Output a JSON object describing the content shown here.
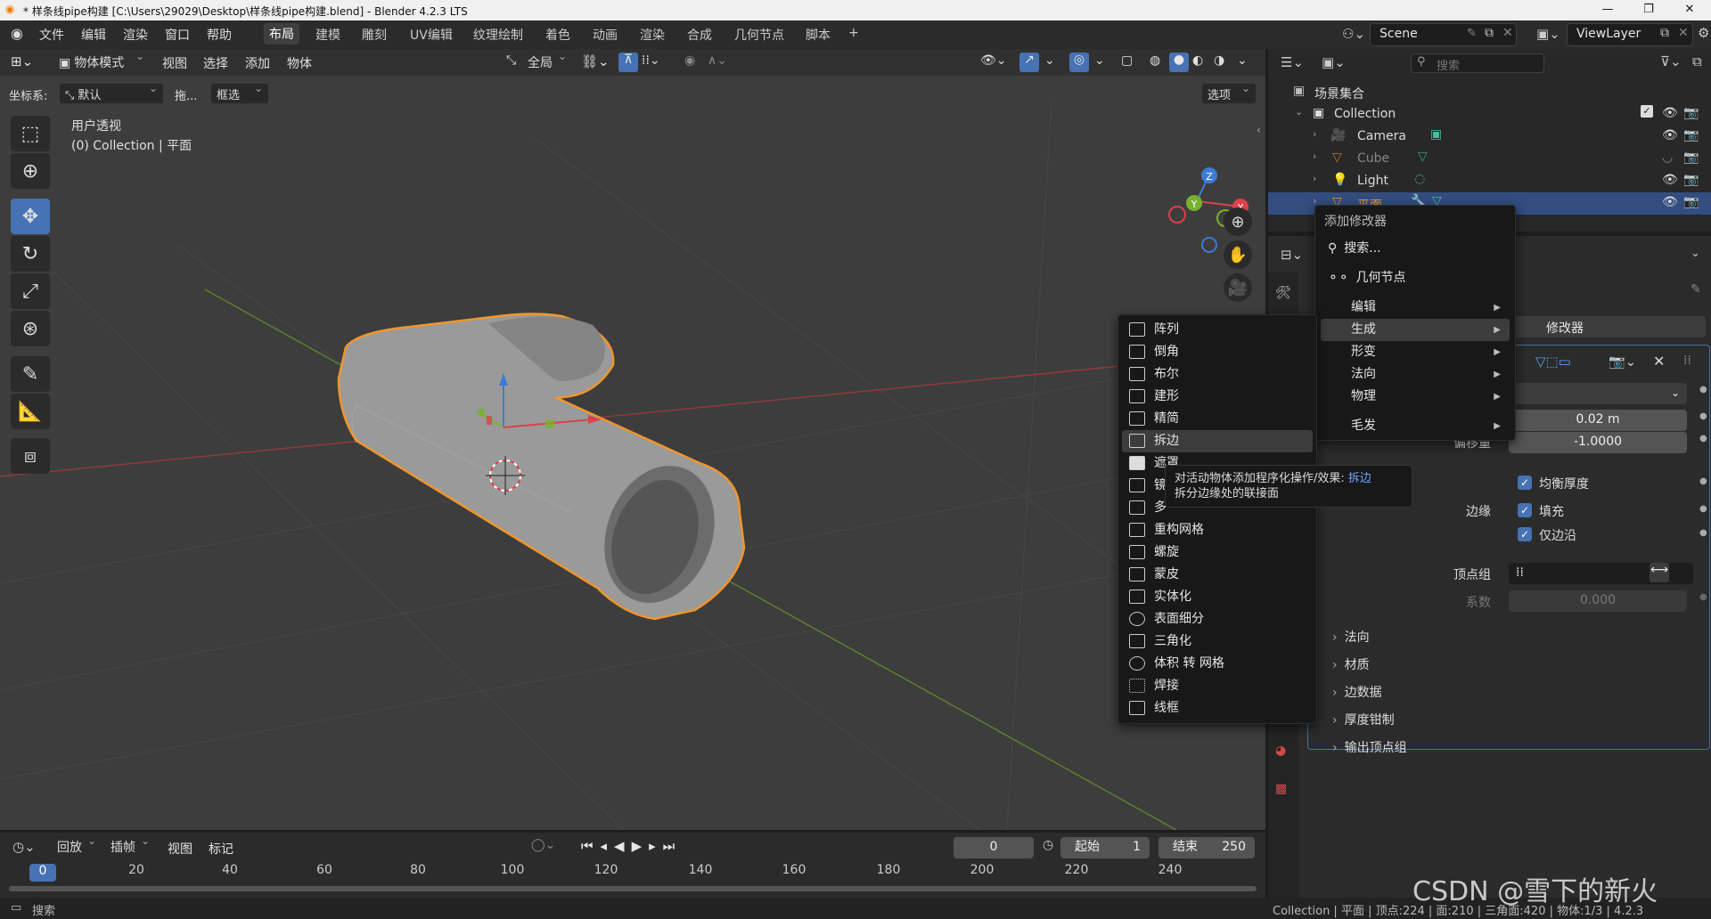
{
  "window": {
    "title": "* 样条线pipe构建 [C:\\Users\\29029\\Desktop\\样条线pipe构建.blend] - Blender 4.2.3 LTS",
    "minimize": "—",
    "maximize": "❐",
    "close": "✕"
  },
  "menubar": [
    "文件",
    "编辑",
    "渲染",
    "窗口",
    "帮助"
  ],
  "workspaces": [
    "布局",
    "建模",
    "雕刻",
    "UV编辑",
    "纹理绘制",
    "着色",
    "动画",
    "渲染",
    "合成",
    "几何节点",
    "脚本",
    "+"
  ],
  "active_workspace": "布局",
  "scene": {
    "scene_name": "Scene",
    "view_layer": "ViewLayer"
  },
  "viewport_header": {
    "mode": "物体模式",
    "menus": [
      "视图",
      "选择",
      "添加",
      "物体"
    ],
    "orientation": "全局",
    "coord_label": "坐标系:",
    "coord_value": "默认",
    "drag_label": "拖...",
    "drag_value": "框选",
    "options": "选项"
  },
  "viewport": {
    "view_name": "用户透视",
    "collection_info": "(0) Collection | 平面",
    "axis_labels": {
      "x": "X",
      "y": "Y",
      "z": "Z"
    }
  },
  "outliner": {
    "search_placeholder": "搜索",
    "root": "场景集合",
    "collection": "Collection",
    "items": [
      {
        "name": "Camera",
        "icon": "camera-icon"
      },
      {
        "name": "Cube",
        "icon": "mesh-icon"
      },
      {
        "name": "Light",
        "icon": "light-icon"
      },
      {
        "name": "平面",
        "icon": "mesh-icon"
      }
    ]
  },
  "add_modifier_menu": {
    "title": "添加修改器",
    "search": "搜索...",
    "geometry_nodes": "几何节点",
    "categories": [
      "编辑",
      "生成",
      "形变",
      "法向",
      "物理",
      "毛发"
    ],
    "active_category": "生成"
  },
  "generate_submenu": {
    "items": [
      "阵列",
      "倒角",
      "布尔",
      "建形",
      "精简",
      "拆边",
      "遮罩",
      "镜",
      "多",
      "重构网格",
      "螺旋",
      "蒙皮",
      "实体化",
      "表面细分",
      "三角化",
      "体积 转 网格",
      "焊接",
      "线框"
    ],
    "highlighted": "拆边"
  },
  "tooltip": {
    "line1": "对活动物体添加程序化操作/效果:",
    "highlight": "拆边",
    "line2": "拆分边缘处的联接面"
  },
  "properties": {
    "add_modifier_partial": "修改器",
    "thickness_value": "0.02 m",
    "offset_label": "偏移量",
    "offset_value": "-1.0000",
    "even_thickness": "均衡厚度",
    "edges_label": "边缘",
    "fill": "填充",
    "rim_only": "仅边沿",
    "vertex_group_label": "顶点组",
    "factor_label": "系数",
    "factor_value": "0.000",
    "panels": [
      "法向",
      "材质",
      "边数据",
      "厚度钳制",
      "输出顶点组"
    ]
  },
  "timeline": {
    "menus": [
      "回放",
      "插帧",
      "视图",
      "标记"
    ],
    "current_frame": "0",
    "start_label": "起始",
    "start_value": "1",
    "end_label": "结束",
    "end_value": "250",
    "ruler": [
      "0",
      "20",
      "40",
      "60",
      "80",
      "100",
      "120",
      "140",
      "160",
      "180",
      "200",
      "220",
      "240"
    ]
  },
  "statusbar": {
    "left": "搜索",
    "right": "Collection | 平面 | 顶点:224 | 面:210 | 三角面:420 | 物体:1/3 | 4.2.3"
  },
  "watermark": "CSDN @雪下的新火",
  "colors": {
    "accent": "#4772b3",
    "selection_outline": "#f0962d",
    "x_axis": "#d9414b",
    "y_axis": "#7ab02f",
    "z_axis": "#3d7bd6"
  }
}
